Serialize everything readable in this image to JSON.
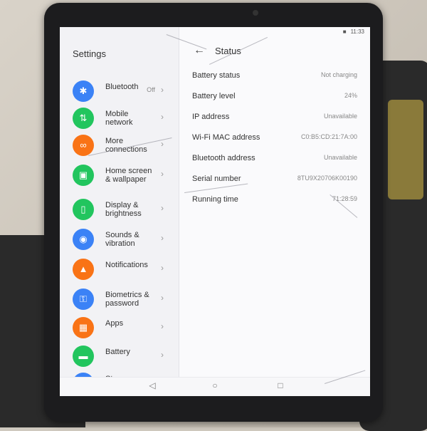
{
  "statusbar": {
    "time": "11:33",
    "sim": "■"
  },
  "settings_panel": {
    "title": "Settings",
    "items": [
      {
        "label": "Bluetooth",
        "value": "Off",
        "icon": "bluetooth-icon",
        "color": "#3b82f6"
      },
      {
        "label": "Mobile network",
        "value": "",
        "icon": "mobile-network-icon",
        "color": "#22c55e"
      },
      {
        "label": "More connections",
        "value": "",
        "icon": "link-icon",
        "color": "#f97316"
      },
      {
        "label": "Home screen & wallpaper",
        "value": "",
        "icon": "image-icon",
        "color": "#22c55e"
      },
      {
        "label": "Display & brightness",
        "value": "",
        "icon": "display-icon",
        "color": "#22c55e"
      },
      {
        "label": "Sounds & vibration",
        "value": "",
        "icon": "sound-icon",
        "color": "#3b82f6"
      },
      {
        "label": "Notifications",
        "value": "",
        "icon": "notification-bell-icon",
        "color": "#f97316"
      },
      {
        "label": "Biometrics & password",
        "value": "",
        "icon": "key-icon",
        "color": "#3b82f6"
      },
      {
        "label": "Apps",
        "value": "",
        "icon": "apps-grid-icon",
        "color": "#f97316"
      },
      {
        "label": "Battery",
        "value": "",
        "icon": "battery-icon",
        "color": "#22c55e"
      },
      {
        "label": "Storage",
        "value": "",
        "icon": "storage-icon",
        "color": "#3b82f6"
      }
    ],
    "icon_glyphs": [
      "✱",
      "⇅",
      "∞",
      "▣",
      "▯",
      "◉",
      "▲",
      "⚿",
      "▦",
      "▬",
      "▤"
    ],
    "chevron": "›"
  },
  "status_panel": {
    "title": "Status",
    "back_glyph": "←",
    "rows": [
      {
        "label": "Battery status",
        "value": "Not charging"
      },
      {
        "label": "Battery level",
        "value": "24%"
      },
      {
        "label": "IP address",
        "value": "Unavailable"
      },
      {
        "label": "Wi-Fi MAC address",
        "value": "C0:B5:CD:21:7A:00"
      },
      {
        "label": "Bluetooth address",
        "value": "Unavailable"
      },
      {
        "label": "Serial number",
        "value": "8TU9X20706K00190"
      },
      {
        "label": "Running time",
        "value": "71:28:59"
      }
    ]
  },
  "navbar": {
    "back": "◁",
    "home": "○",
    "recents": "□"
  }
}
